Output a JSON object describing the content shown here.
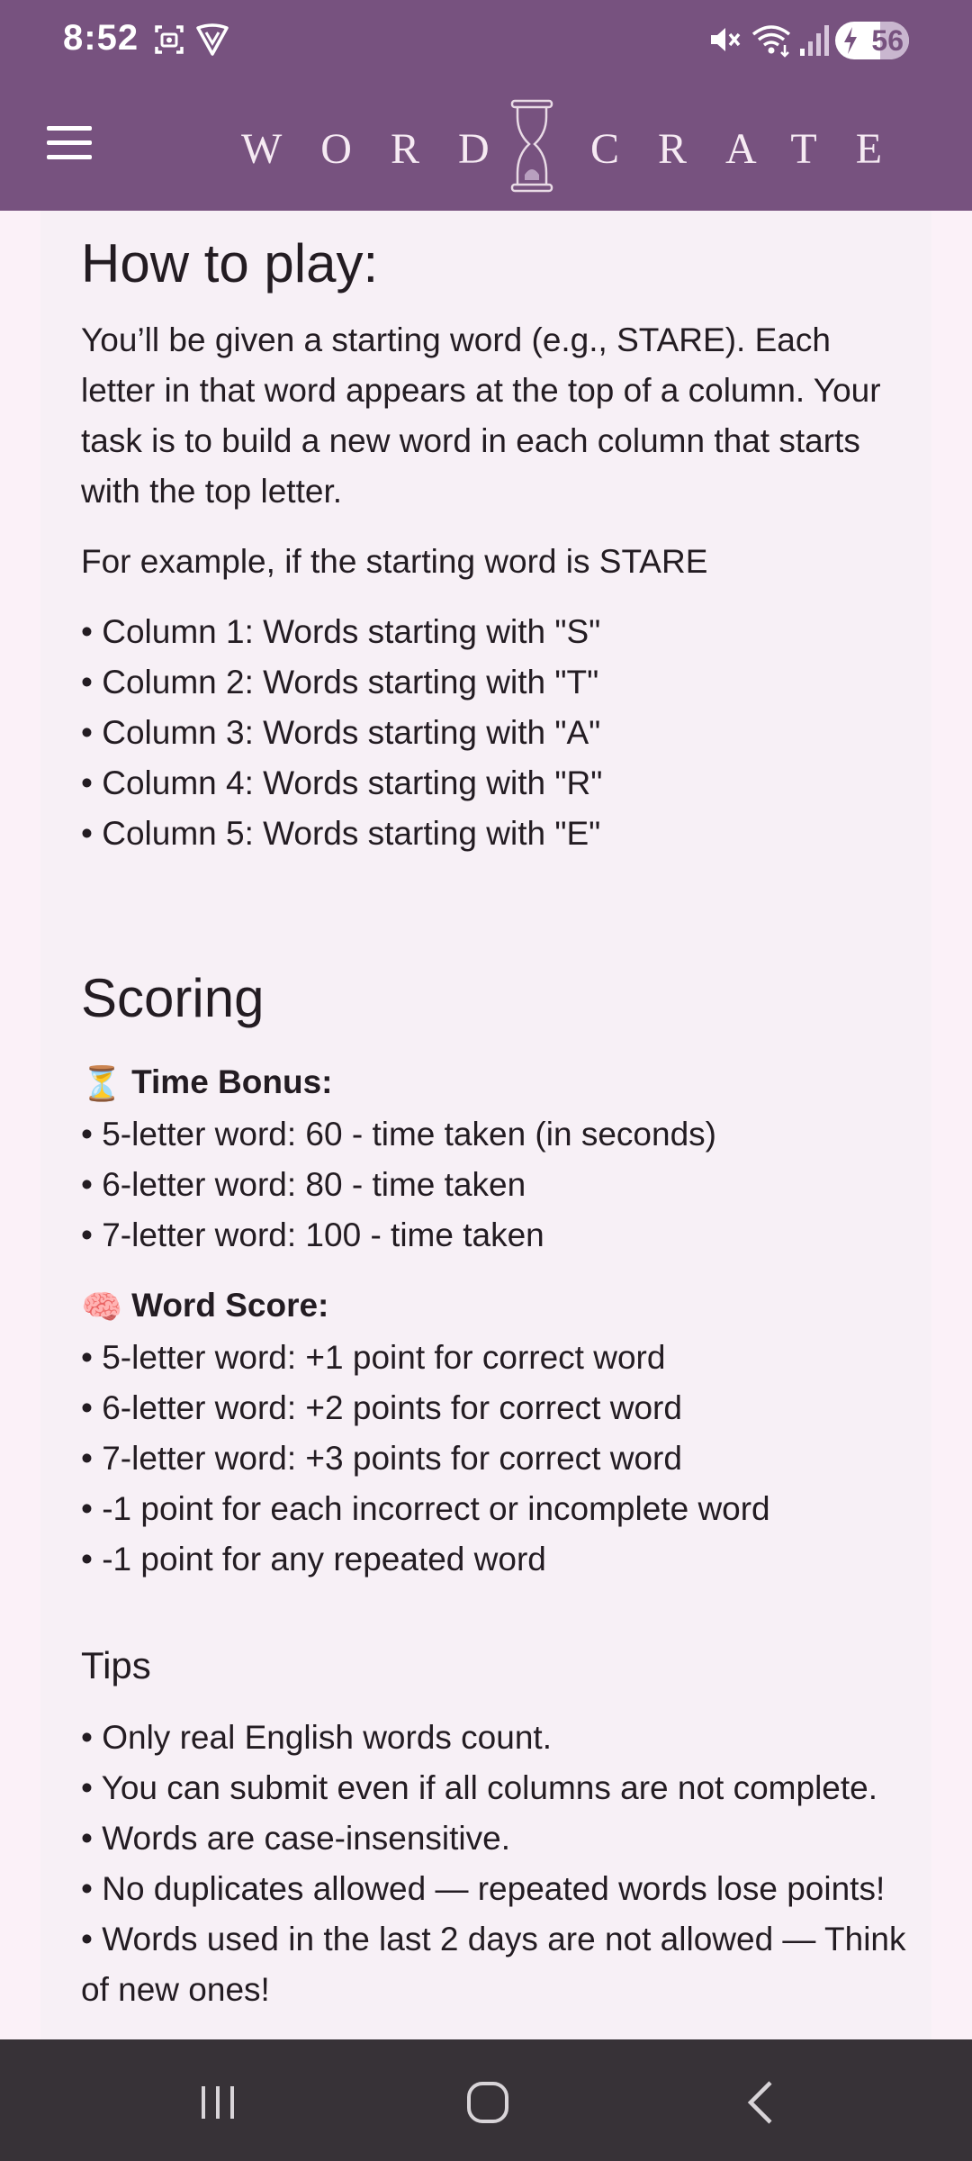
{
  "status_bar": {
    "time": "8:52",
    "battery_percent": "56",
    "icons": [
      "screenshot-icon",
      "vpn-shield-icon",
      "mute-icon",
      "wifi-icon",
      "signal-icon"
    ]
  },
  "app": {
    "logo_left": "WORD",
    "logo_right": "CRATE",
    "menu_icon": "hamburger-menu-icon"
  },
  "how_to_play": {
    "title": "How to play:",
    "intro": "You’ll be given a starting word (e.g., STARE). Each letter in that word appears at the top of a column. Your task is to build a new word in each column that starts with the top letter.",
    "example_intro": "For example, if the starting word is STARE",
    "columns": [
      "• Column 1: Words starting with \"S\"",
      "• Column 2: Words starting with \"T\"",
      "• Column 3: Words starting with \"A\"",
      "• Column 4: Words starting with \"R\"",
      "• Column 5: Words starting with \"E\""
    ]
  },
  "scoring": {
    "title": "Scoring",
    "time_bonus": {
      "emoji": "⏳",
      "heading": "Time Bonus:",
      "items": [
        "• 5-letter word: 60 - time taken (in seconds)",
        "• 6-letter word: 80 - time taken",
        "• 7-letter word: 100 - time taken"
      ]
    },
    "word_score": {
      "emoji": "🧠",
      "heading": "Word Score:",
      "items": [
        "• 5-letter word: +1 point for correct word",
        "• 6-letter word: +2 points for correct word",
        "• 7-letter word: +3 points for correct word",
        "• -1 point for each incorrect or incomplete word",
        "• -1 point for any repeated word"
      ]
    }
  },
  "tips": {
    "title": "Tips",
    "items": [
      "• Only real English words count.",
      "• You can submit even if all columns are not complete.",
      "• Words are case-insensitive.",
      "• No duplicates allowed — repeated words lose points!",
      "• Words used in the last 2 days are not allowed — Think of new ones!"
    ]
  },
  "nav_bar": {
    "icons": [
      "recent-apps-icon",
      "home-icon",
      "back-icon"
    ]
  },
  "colors": {
    "header_purple": "#77527f",
    "page_background": "#fbf1f8",
    "card_background": "#f7f0f6",
    "text": "#231c22"
  }
}
